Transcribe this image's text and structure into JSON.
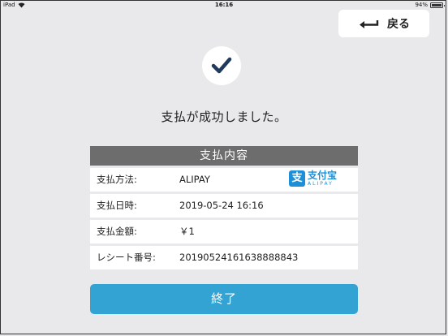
{
  "status_bar": {
    "device": "iPad",
    "time": "16:16",
    "battery": "94%"
  },
  "header": {
    "back_label": "戻る"
  },
  "result": {
    "message": "支払が成功しました。"
  },
  "details": {
    "title": "支払内容",
    "rows": [
      {
        "label": "支払方法:",
        "value": "ALIPAY"
      },
      {
        "label": "支払日時:",
        "value": "2019-05-24 16:16"
      },
      {
        "label": "支払金額:",
        "value": "￥1"
      },
      {
        "label": "レシート番号:",
        "value": "20190524161638888843"
      }
    ],
    "payment_logo": {
      "mark": "支",
      "name": "支付宝",
      "latin": "ALIPAY"
    }
  },
  "actions": {
    "finish_label": "終了"
  },
  "colors": {
    "accent": "#33a3d4",
    "check": "#1f3a5c",
    "header": "#6d6d6d"
  }
}
